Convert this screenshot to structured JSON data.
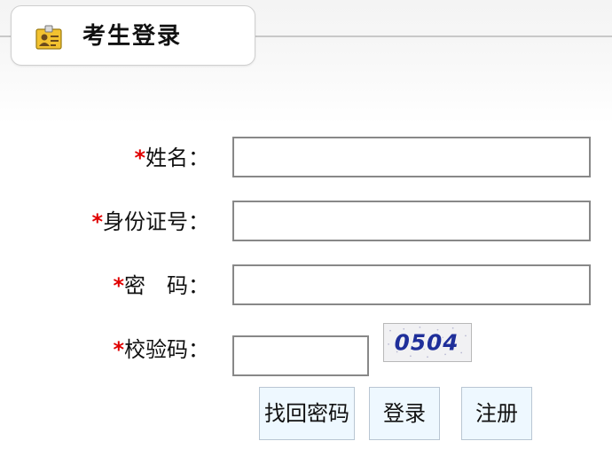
{
  "tab": {
    "title": "考生登录",
    "icon": "id-card-icon"
  },
  "form": {
    "required_mark": "*",
    "name_label": "姓名：",
    "id_label": "身份证号：",
    "password_label": "密　码：",
    "captcha_label": "校验码：",
    "name_value": "",
    "id_value": "",
    "password_value": "",
    "captcha_value": ""
  },
  "captcha": {
    "text": "0504"
  },
  "buttons": {
    "recover": "找回密码",
    "login": "登录",
    "register": "注册"
  },
  "colors": {
    "required": "#e00000",
    "button_bg": "#eef8ff",
    "captcha_text": "#1f2f9a"
  }
}
